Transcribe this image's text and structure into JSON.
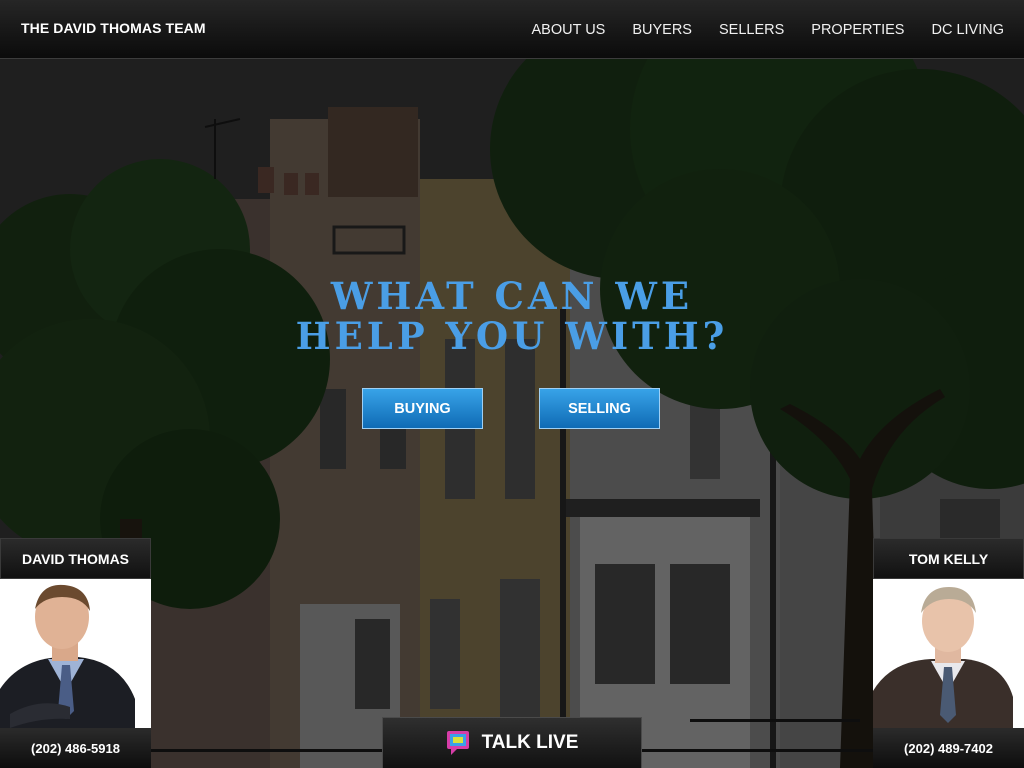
{
  "header": {
    "brand": "THE DAVID THOMAS TEAM",
    "nav": [
      "ABOUT US",
      "BUYERS",
      "SELLERS",
      "PROPERTIES",
      "DC LIVING"
    ]
  },
  "hero": {
    "headline_line1": "WHAT CAN WE",
    "headline_line2": "HELP YOU WITH?",
    "buttons": {
      "buying": "BUYING",
      "selling": "SELLING"
    }
  },
  "agents": [
    {
      "name": "DAVID THOMAS",
      "phone": "(202) 486-5918"
    },
    {
      "name": "TOM KELLY",
      "phone": "(202) 489-7402"
    }
  ],
  "talk_live": {
    "label": "TALK LIVE",
    "icon": "chat-bubble-icon"
  },
  "colors": {
    "headline": "#4a9ee6",
    "button_top": "#38a3e8",
    "button_bottom": "#0f6bb5",
    "header_bg": "#0b0b0b"
  }
}
